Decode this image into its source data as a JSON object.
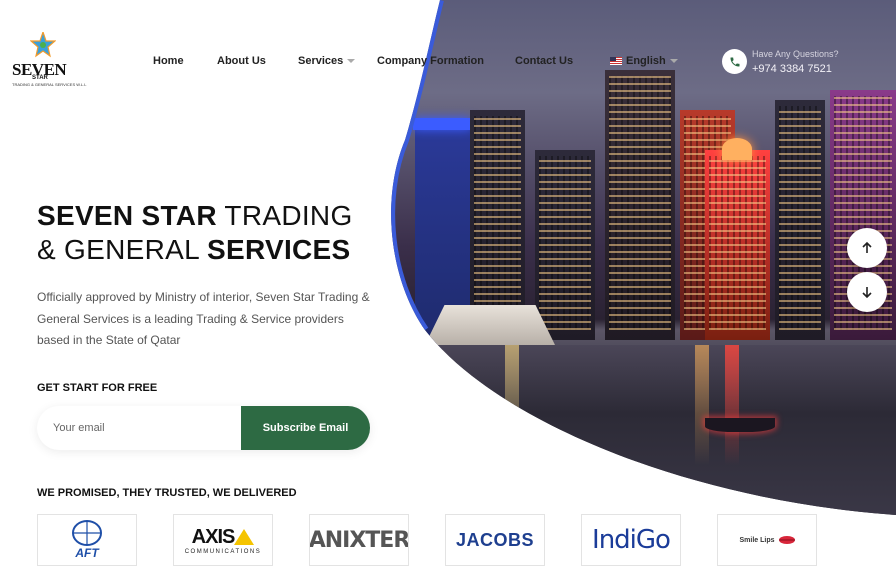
{
  "brand": {
    "logo_text": "SEVEN",
    "logo_sub": "STAR",
    "logo_tagline": "TRADING & GENERAL SERVICES W.L.L"
  },
  "nav": {
    "home": "Home",
    "about": "About Us",
    "services": "Services",
    "company_formation": "Company Formation",
    "contact": "Contact Us",
    "language": "English"
  },
  "contact": {
    "question": "Have Any Questions?",
    "phone": "+974 3384 7521"
  },
  "hero": {
    "title_bold_1": "SEVEN STAR",
    "title_light_1": " TRADING",
    "title_light_2": "& GENERAL ",
    "title_bold_2": "SERVICES",
    "description": "Officially approved by Ministry of interior, Seven Star Trading & General Services is a leading Trading & Service providers based in the State of Qatar"
  },
  "signup": {
    "label": "GET START FOR FREE",
    "placeholder": "Your email",
    "button": "Subscribe Email"
  },
  "clients": {
    "heading": "WE PROMISED, THEY TRUSTED, WE DELIVERED",
    "logos": [
      {
        "name": "AFT"
      },
      {
        "name": "AXIS",
        "sub": "COMMUNICATIONS"
      },
      {
        "name": "ANIXTER"
      },
      {
        "name": "JACOBS"
      },
      {
        "name": "IndiGo"
      },
      {
        "name": "Smile Lips"
      }
    ]
  },
  "colors": {
    "primary": "#2d6a43",
    "accent_blue": "#3a5bd9"
  }
}
